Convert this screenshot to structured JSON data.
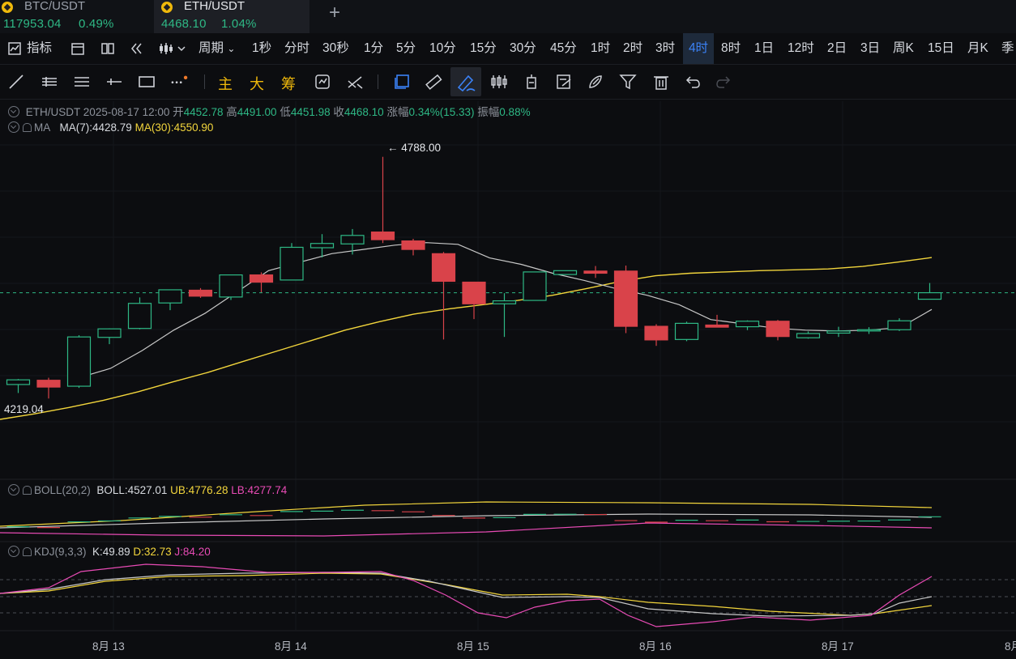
{
  "tickers": [
    {
      "pair": "BTC/USDT",
      "price": "117953.04",
      "change": "0.49%",
      "active": false
    },
    {
      "pair": "ETH/USDT",
      "price": "4468.10",
      "change": "1.04%",
      "active": true
    }
  ],
  "toolbar": {
    "indicators_label": "指标",
    "period_label": "周期",
    "intervals": [
      "1秒",
      "分时",
      "30秒",
      "1分",
      "5分",
      "10分",
      "15分",
      "30分",
      "45分",
      "1时",
      "2时",
      "3时",
      "4时",
      "8时",
      "1日",
      "12时",
      "2日",
      "3日",
      "周K",
      "15日",
      "月K",
      "季"
    ],
    "selected_interval": "4时"
  },
  "drawing_toolbar": {
    "text_tools": [
      "主",
      "大",
      "筹"
    ]
  },
  "ohlc": {
    "symbol": "ETH/USDT",
    "datetime": "2025-08-17 12:00",
    "open_label": "开",
    "open": "4452.78",
    "high_label": "高",
    "high": "4491.00",
    "low_label": "低",
    "low": "4451.98",
    "close_label": "收",
    "close": "4468.10",
    "change_label": "涨幅",
    "change": "0.34%(15.33)",
    "amplitude_label": "振幅",
    "amplitude": "0.88%"
  },
  "ma": {
    "name": "MA",
    "ma7_label": "MA(7):4428.79",
    "ma30_label": "MA(30):4550.90"
  },
  "boll": {
    "name": "BOLL(20,2)",
    "boll_label": "BOLL:4527.01",
    "ub_label": "UB:4776.28",
    "lb_label": "LB:4277.74"
  },
  "kdj": {
    "name": "KDJ(9,3,3)",
    "k_label": "K:49.89",
    "d_label": "D:32.73",
    "j_label": "J:84.20"
  },
  "annotations": {
    "high_marker": "← 4788.00",
    "low_marker": "4219.04"
  },
  "x_axis": [
    "8月 13",
    "8月 14",
    "8月 15",
    "8月 16",
    "8月 17",
    "8月"
  ],
  "colors": {
    "up": "#2eb885",
    "down": "#d9434a",
    "ma7": "#c8c8c8",
    "ma30": "#f2d53c",
    "boll_lb": "#e84bb5",
    "kdj_j": "#e84bb5",
    "selected": "#3b82f6"
  },
  "chart_data": {
    "type": "candlestick",
    "timeframe": "4h",
    "candles": [
      {
        "o": 4252,
        "h": 4265,
        "l": 4232,
        "c": 4263
      },
      {
        "o": 4262,
        "h": 4268,
        "l": 4219.04,
        "c": 4246
      },
      {
        "o": 4248,
        "h": 4368,
        "l": 4244,
        "c": 4364
      },
      {
        "o": 4363,
        "h": 4384,
        "l": 4347,
        "c": 4383
      },
      {
        "o": 4384,
        "h": 4457,
        "l": 4382,
        "c": 4443
      },
      {
        "o": 4444,
        "h": 4474,
        "l": 4427,
        "c": 4475
      },
      {
        "o": 4474,
        "h": 4479,
        "l": 4456,
        "c": 4460
      },
      {
        "o": 4458,
        "h": 4506,
        "l": 4451,
        "c": 4510
      },
      {
        "o": 4510,
        "h": 4516,
        "l": 4469,
        "c": 4493
      },
      {
        "o": 4498,
        "h": 4585,
        "l": 4500,
        "c": 4575
      },
      {
        "o": 4574,
        "h": 4606,
        "l": 4551,
        "c": 4584
      },
      {
        "o": 4583,
        "h": 4618,
        "l": 4558,
        "c": 4603
      },
      {
        "o": 4611,
        "h": 4788,
        "l": 4585,
        "c": 4593
      },
      {
        "o": 4590,
        "h": 4595,
        "l": 4556,
        "c": 4570
      },
      {
        "o": 4560,
        "h": 4564,
        "l": 4358,
        "c": 4495
      },
      {
        "o": 4493,
        "h": 4494,
        "l": 4406,
        "c": 4442
      },
      {
        "o": 4442,
        "h": 4467,
        "l": 4364,
        "c": 4449
      },
      {
        "o": 4450,
        "h": 4517,
        "l": 4453,
        "c": 4517
      },
      {
        "o": 4511,
        "h": 4512,
        "l": 4516,
        "c": 4520
      },
      {
        "o": 4519,
        "h": 4531,
        "l": 4503,
        "c": 4514
      },
      {
        "o": 4519,
        "h": 4532,
        "l": 4373,
        "c": 4389
      },
      {
        "o": 4389,
        "h": 4394,
        "l": 4343,
        "c": 4357
      },
      {
        "o": 4358,
        "h": 4400,
        "l": 4354,
        "c": 4396
      },
      {
        "o": 4392,
        "h": 4416,
        "l": 4387,
        "c": 4387
      },
      {
        "o": 4388,
        "h": 4403,
        "l": 4380,
        "c": 4401
      },
      {
        "o": 4401,
        "h": 4404,
        "l": 4356,
        "c": 4365
      },
      {
        "o": 4362,
        "h": 4377,
        "l": 4360,
        "c": 4372
      },
      {
        "o": 4373,
        "h": 4388,
        "l": 4364,
        "c": 4378
      },
      {
        "o": 4378,
        "h": 4387,
        "l": 4371,
        "c": 4381
      },
      {
        "o": 4381,
        "h": 4408,
        "l": 4378,
        "c": 4402
      },
      {
        "o": 4452.78,
        "h": 4491,
        "l": 4451.98,
        "c": 4468.1
      }
    ],
    "ma7": [
      4268,
      4290,
      4332,
      4380,
      4420,
      4470,
      4520,
      4540,
      4560,
      4570,
      4580,
      4586,
      4582,
      4550,
      4535,
      4514,
      4497,
      4478,
      4462,
      4440,
      4405,
      4395,
      4385,
      4380,
      4378,
      4380,
      4386,
      4428.79
    ],
    "ma30": [
      4170,
      4183,
      4198,
      4215,
      4235,
      4258,
      4280,
      4305,
      4330,
      4355,
      4380,
      4400,
      4418,
      4430,
      4440,
      4450,
      4462,
      4478,
      4495,
      4508,
      4514,
      4517,
      4520,
      4522,
      4524,
      4530,
      4540,
      4550.9
    ],
    "boll": {
      "ub": 4776.28,
      "mid": 4527.01,
      "lb": 4277.74
    },
    "kdj": {
      "k": 49.89,
      "d": 32.73,
      "j": 84.2
    },
    "current_price": 4468.1,
    "annotated_high": 4788.0,
    "annotated_low": 4219.04
  }
}
